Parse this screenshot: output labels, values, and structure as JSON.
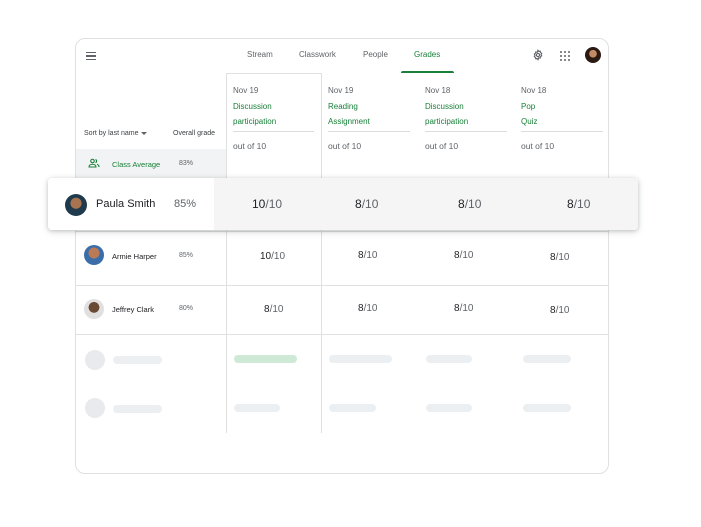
{
  "nav": {
    "tabs": [
      {
        "label": "Stream"
      },
      {
        "label": "Classwork"
      },
      {
        "label": "People"
      },
      {
        "label": "Grades"
      }
    ],
    "active_tab": "Grades",
    "accent_color": "#188038"
  },
  "gradebook": {
    "sort_label": "Sort by last name",
    "overall_label": "Overall grade",
    "class_average": {
      "label": "Class Average",
      "value": "83%"
    },
    "assignments": [
      {
        "date": "Nov 19",
        "title_line1": "Discussion",
        "title_line2": "participation",
        "out_of": "out of 10"
      },
      {
        "date": "Nov 19",
        "title_line1": "Reading",
        "title_line2": "Assignment",
        "out_of": "out of 10"
      },
      {
        "date": "Nov 18",
        "title_line1": "Discussion",
        "title_line2": "participation",
        "out_of": "out of 10"
      },
      {
        "date": "Nov 18",
        "title_line1": "Pop",
        "title_line2": "Quiz",
        "out_of": "out of 10"
      }
    ],
    "highlighted_student": {
      "name": "Paula Smith",
      "overall": "85%",
      "grades": [
        {
          "score": "10",
          "denominator": "/10"
        },
        {
          "score": "8",
          "denominator": "/10"
        },
        {
          "score": "8",
          "denominator": "/10"
        },
        {
          "score": "8",
          "denominator": "/10"
        }
      ]
    },
    "students": [
      {
        "name": "Armie Harper",
        "overall": "85%",
        "grades": [
          {
            "score": "10",
            "denominator": "/10"
          },
          {
            "score": "8",
            "denominator": "/10"
          },
          {
            "score": "8",
            "denominator": "/10"
          },
          {
            "score": "8",
            "denominator": "/10"
          }
        ]
      },
      {
        "name": "Jeffrey Clark",
        "overall": "80%",
        "grades": [
          {
            "score": "8",
            "denominator": "/10"
          },
          {
            "score": "8",
            "denominator": "/10"
          },
          {
            "score": "8",
            "denominator": "/10"
          },
          {
            "score": "8",
            "denominator": "/10"
          }
        ]
      }
    ]
  },
  "icons": {
    "menu": "hamburger-menu-icon",
    "settings": "gear-icon",
    "apps": "apps-grid-icon",
    "class_average": "people-group-icon"
  }
}
